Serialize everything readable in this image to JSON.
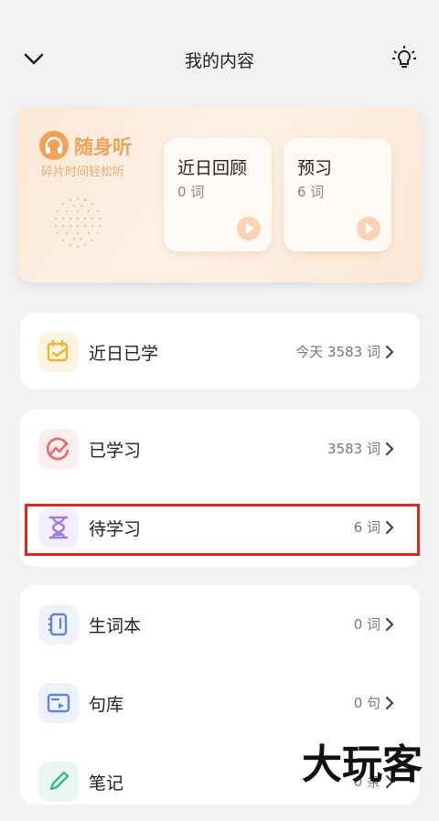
{
  "header": {
    "title": "我的内容"
  },
  "banner": {
    "brand_name": "随身听",
    "brand_subtitle": "碎片时间轻松听",
    "cards": [
      {
        "title": "近日回顾",
        "count": "0 词"
      },
      {
        "title": "预习",
        "count": "6 词"
      }
    ]
  },
  "groups": {
    "recent": [
      {
        "label": "近日已学",
        "value": "今天 3583 词"
      }
    ],
    "progress": [
      {
        "label": "已学习",
        "value": "3583 词"
      },
      {
        "label": "待学习",
        "value": "6 词"
      }
    ],
    "collections": [
      {
        "label": "生词本",
        "value": "0 词"
      },
      {
        "label": "句库",
        "value": "0 句"
      },
      {
        "label": "笔记",
        "value": "0 条"
      }
    ]
  },
  "watermark": "大玩客",
  "colors": {
    "accent_orange": "#f0a25a",
    "highlight_red": "#e6241c"
  }
}
